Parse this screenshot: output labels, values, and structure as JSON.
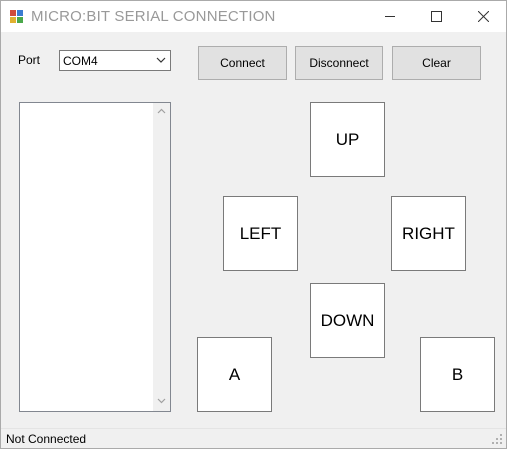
{
  "window": {
    "title": "MICRO:BIT SERIAL CONNECTION"
  },
  "port": {
    "label": "Port",
    "selected": "COM4"
  },
  "toolbar": {
    "connect_label": "Connect",
    "disconnect_label": "Disconnect",
    "clear_label": "Clear"
  },
  "serial_output": {
    "text": ""
  },
  "pad": {
    "up": "UP",
    "left": "LEFT",
    "right": "RIGHT",
    "down": "DOWN",
    "a": "A",
    "b": "B"
  },
  "status": {
    "text": "Not Connected"
  },
  "icons": {
    "app": "app-windows-form-icon",
    "minimize": "minimize-icon",
    "maximize": "maximize-icon",
    "close": "close-icon"
  }
}
